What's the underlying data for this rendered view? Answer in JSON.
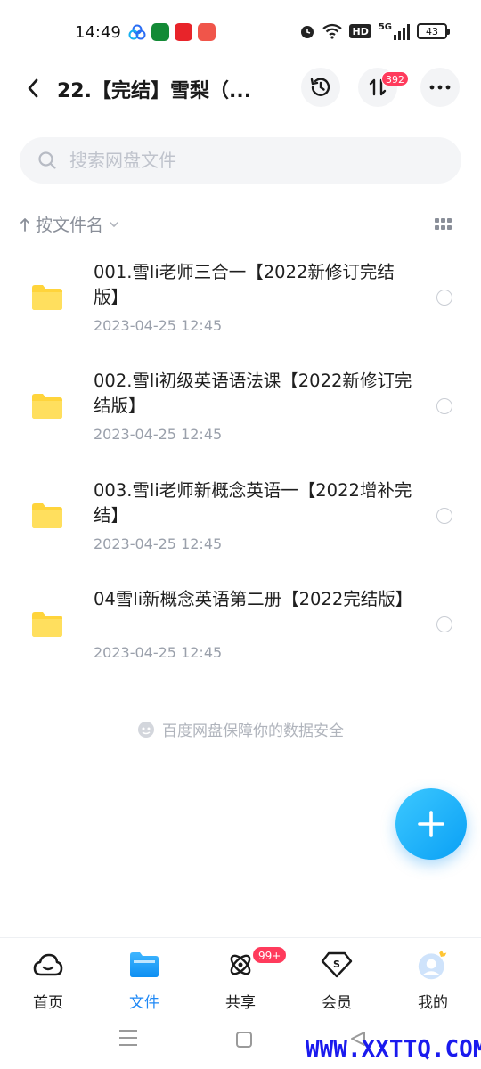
{
  "status_bar": {
    "time": "14:49",
    "battery": "43",
    "network": "5G",
    "hd_label": "HD"
  },
  "header": {
    "title": "22.【完结】雪梨（...",
    "transfer_badge": "392"
  },
  "search": {
    "placeholder": "搜索网盘文件"
  },
  "sort": {
    "label": "按文件名"
  },
  "files": [
    {
      "name": "001.雪li老师三合一【2022新修订完结版】",
      "date": "2023-04-25  12:45"
    },
    {
      "name": "002.雪li初级英语语法课【2022新修订完结版】",
      "date": "2023-04-25  12:45"
    },
    {
      "name": "003.雪li老师新概念英语一【2022增补完结】",
      "date": "2023-04-25  12:45"
    },
    {
      "name": "04雪li新概念英语第二册【2022完结版】",
      "date": "2023-04-25  12:45"
    }
  ],
  "safety_notice": "百度网盘保障你的数据安全",
  "tabs": [
    {
      "label": "首页",
      "icon": "cloud-icon"
    },
    {
      "label": "文件",
      "icon": "folder-icon"
    },
    {
      "label": "共享",
      "icon": "atom-icon"
    },
    {
      "label": "会员",
      "icon": "vip-diamond-icon"
    },
    {
      "label": "我的",
      "icon": "avatar-icon"
    }
  ],
  "share_badge": "99+",
  "watermark": "WWW.XXTTQ.COM",
  "colors": {
    "accent": "#1e88f5",
    "badge": "#ff3b5c",
    "folder": "#ffd43b"
  }
}
